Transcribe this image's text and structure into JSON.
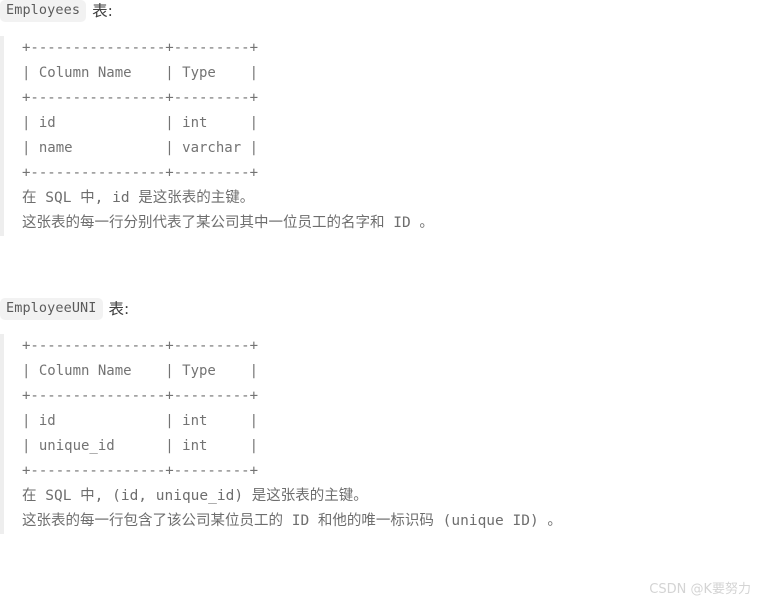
{
  "page": {
    "background": "#ffffff",
    "text_color": "#737373",
    "badge_background": "#f2f2f2",
    "left_rule_color": "#eeeeee",
    "watermark_color": "#d4d4d4"
  },
  "sections": [
    {
      "badge": "Employees",
      "suffix": "表:",
      "ascii_table": "+----------------+---------+\n| Column Name    | Type    |\n+----------------+---------+\n| id             | int     |\n| name           | varchar |\n+----------------+---------+",
      "notes": "在 SQL 中, id 是这张表的主键。\n这张表的每一行分别代表了某公司其中一位员工的名字和 ID 。",
      "table": {
        "headers": [
          "Column Name",
          "Type"
        ],
        "rows": [
          [
            "id",
            "int"
          ],
          [
            "name",
            "varchar"
          ]
        ]
      }
    },
    {
      "badge": "EmployeeUNI",
      "suffix": "表:",
      "ascii_table": "+----------------+---------+\n| Column Name    | Type    |\n+----------------+---------+\n| id             | int     |\n| unique_id      | int     |\n+----------------+---------+",
      "notes": "在 SQL 中, (id, unique_id) 是这张表的主键。\n这张表的每一行包含了该公司某位员工的 ID 和他的唯一标识码 (unique ID) 。",
      "table": {
        "headers": [
          "Column Name",
          "Type"
        ],
        "rows": [
          [
            "id",
            "int"
          ],
          [
            "unique_id",
            "int"
          ]
        ]
      }
    }
  ],
  "watermark": "CSDN @K要努力"
}
